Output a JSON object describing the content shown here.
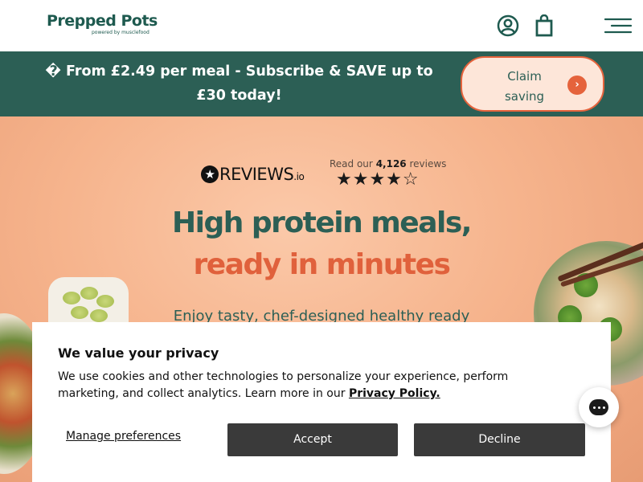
{
  "header": {
    "logo_main": "Prepped Pots",
    "logo_sub": "powered by musclefood",
    "icons": [
      "account-icon",
      "bag-icon",
      "menu-icon"
    ]
  },
  "promo": {
    "text": "� From £2.49 per meal - Subscribe & SAVE up to £30 today!",
    "claim_label": "Claim saving",
    "arrow_glyph": "›"
  },
  "reviews": {
    "logo_text": "REVIEWS",
    "logo_suffix": ".io",
    "read_prefix": "Read our",
    "count": "4,126",
    "read_suffix": "reviews",
    "stars_glyphs": "★★★★☆",
    "rating_stars": 4.5
  },
  "hero": {
    "headline_line1": "High protein meals,",
    "headline_line2": "ready in minutes",
    "subtext": "Enjoy tasty, chef-designed healthy ready"
  },
  "cookie": {
    "title": "We value your privacy",
    "body": "We use cookies and other technologies to personalize your experience, perform marketing, and collect analytics. Learn more in our",
    "policy_link": "Privacy Policy.",
    "manage_label": "Manage preferences",
    "accept_label": "Accept",
    "decline_label": "Decline"
  },
  "colors": {
    "brand_green": "#2c5f55",
    "accent_orange": "#e0613c",
    "hero_peach": "#f6b48d",
    "button_dark": "#3a3a3a"
  }
}
